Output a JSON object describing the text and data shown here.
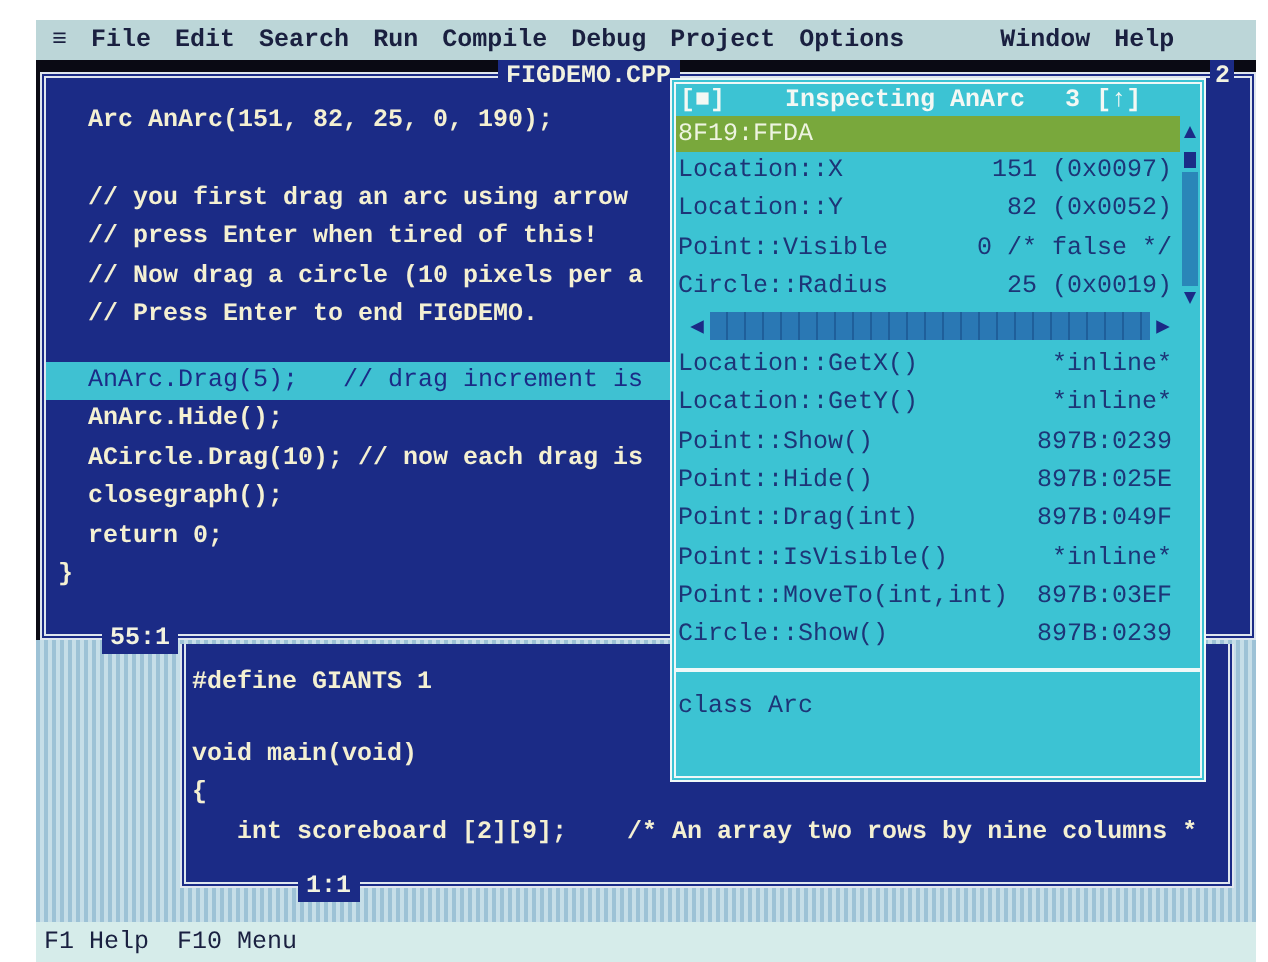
{
  "menu": [
    {
      "label": "≡"
    },
    {
      "label": "File"
    },
    {
      "label": "Edit"
    },
    {
      "label": "Search"
    },
    {
      "label": "Run"
    },
    {
      "label": "Compile"
    },
    {
      "label": "Debug"
    },
    {
      "label": "Project"
    },
    {
      "label": "Options"
    },
    {
      "label": "Window"
    },
    {
      "label": "Help"
    }
  ],
  "editor": {
    "title": "FIGDEMO.CPP",
    "number": "2",
    "position": "55:1",
    "blocks": [
      [
        {
          "text": "  Arc AnArc(151, 82, 25, 0, 190);",
          "selected": false
        }
      ],
      [
        {
          "text": "  // you first drag an arc using arrow",
          "selected": false
        },
        {
          "text": "  // press Enter when tired of this!",
          "selected": false
        },
        {
          "text": "  // Now drag a circle (10 pixels per a",
          "selected": false
        },
        {
          "text": "  // Press Enter to end FIGDEMO.",
          "selected": false
        }
      ],
      [
        {
          "text": "  AnArc.Drag(5);   // drag increment is",
          "selected": true
        },
        {
          "text": "  AnArc.Hide();",
          "selected": false
        },
        {
          "text": "  ACircle.Drag(10); // now each drag is",
          "selected": false
        },
        {
          "text": "  closegraph();",
          "selected": false
        },
        {
          "text": "  return 0;",
          "selected": false
        },
        {
          "text": "}",
          "selected": false
        }
      ]
    ]
  },
  "inspector": {
    "close_button": "[■]",
    "title": "Inspecting AnArc",
    "number": "3",
    "zoom_button": "[↑]",
    "address": "8F19:FFDA",
    "fields": [
      {
        "name": "Location::X",
        "value": "151 (0x0097)"
      },
      {
        "name": "Location::Y",
        "value": "82 (0x0052)"
      },
      {
        "name": "Point::Visible",
        "value": "0 /* false */"
      },
      {
        "name": "Circle::Radius",
        "value": "25 (0x0019)"
      }
    ],
    "methods": [
      {
        "name": "Location::GetX()",
        "value": "*inline*"
      },
      {
        "name": "Location::GetY()",
        "value": "*inline*"
      },
      {
        "name": "Point::Show()",
        "value": "897B:0239"
      },
      {
        "name": "Point::Hide()",
        "value": "897B:025E"
      },
      {
        "name": "Point::Drag(int)",
        "value": "897B:049F"
      },
      {
        "name": "Point::IsVisible()",
        "value": "*inline*"
      },
      {
        "name": "Point::MoveTo(int,int)",
        "value": "897B:03EF"
      },
      {
        "name": "Circle::Show()",
        "value": "897B:0239"
      }
    ],
    "type": "class Arc"
  },
  "editor2": {
    "position": "1:1",
    "blocks": [
      [
        "#define GIANTS 1"
      ],
      [
        "void main(void)",
        "{",
        "   int scoreboard [2][9];    /* An array two rows by nine columns *"
      ]
    ]
  },
  "status_bar": [
    {
      "key": "F1",
      "label": "Help"
    },
    {
      "key": "F10",
      "label": "Menu"
    }
  ]
}
